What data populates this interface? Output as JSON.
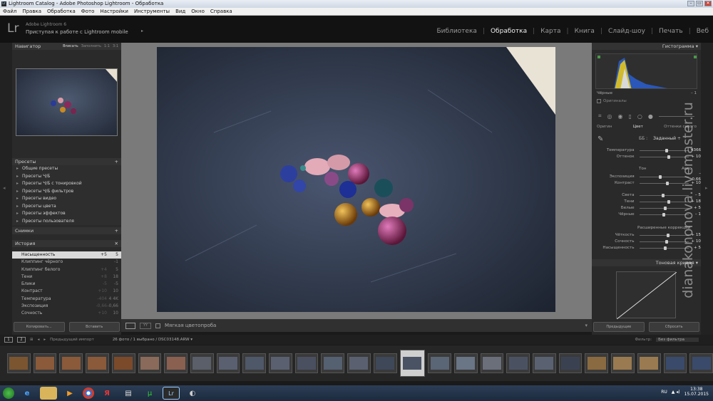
{
  "window": {
    "title": "Lightroom Catalog - Adobe Photoshop Lightroom - Обработка",
    "controls": [
      "–",
      "▭",
      "✕"
    ]
  },
  "menu": [
    "Файл",
    "Правка",
    "Обработка",
    "Фото",
    "Настройки",
    "Инструменты",
    "Вид",
    "Окно",
    "Справка"
  ],
  "identity": {
    "logo": "Lr",
    "version": "Adobe Lightroom 6",
    "sync": "Приступая к работе с Lightroom mobile",
    "arrow": "▸"
  },
  "modules": [
    {
      "label": "Библиотека",
      "active": false
    },
    {
      "label": "Обработка",
      "active": true
    },
    {
      "label": "Карта",
      "active": false
    },
    {
      "label": "Книга",
      "active": false
    },
    {
      "label": "Слайд-шоу",
      "active": false
    },
    {
      "label": "Печать",
      "active": false
    },
    {
      "label": "Веб",
      "active": false
    }
  ],
  "navigator": {
    "title": "Навигатор",
    "fit": "Вписать",
    "fill": "Заполнить",
    "z1": "1:1",
    "z3": "3:1"
  },
  "presets": {
    "title": "Пресеты",
    "items": [
      "Общие пресеты",
      "Пресеты Ч/Б",
      "Пресеты Ч/Б с тонировкой",
      "Пресеты Ч/Б фильтров",
      "Пресеты видео",
      "Пресеты цвета",
      "Пресеты эффектов",
      "Пресеты пользователя"
    ]
  },
  "snapshots": {
    "title": "Снимки"
  },
  "history": {
    "title": "История",
    "items": [
      {
        "name": "Насыщенность",
        "a": "+5",
        "b": "5",
        "selected": true
      },
      {
        "name": "Клиппинг чёрного",
        "a": "",
        "b": "-1"
      },
      {
        "name": "Клиппинг белого",
        "a": "+4",
        "b": "5"
      },
      {
        "name": "Тени",
        "a": "+8",
        "b": "18"
      },
      {
        "name": "Блики",
        "a": "-5",
        "b": "-5"
      },
      {
        "name": "Контраст",
        "a": "+10",
        "b": "10"
      },
      {
        "name": "Температура",
        "a": "-404",
        "b": "4 4K"
      },
      {
        "name": "Экспозиция",
        "a": "-0,66",
        "b": "-0,66"
      },
      {
        "name": "Сочность",
        "a": "+10",
        "b": "10"
      }
    ]
  },
  "left_buttons": {
    "copy": "Копировать...",
    "paste": "Вставить"
  },
  "toolbar": {
    "softproof": "Мягкая цветопроба"
  },
  "histogram": {
    "title": "Гистограмма",
    "blacks": "Чёрные",
    "blacks_val": "– 1",
    "originals": "Оригиналы"
  },
  "basic": {
    "tabs": [
      "Оригин",
      "Цвет",
      "Оттенки серого"
    ],
    "wb_label": "ББ :",
    "wb_value": "Заданный ÷",
    "temp": {
      "label": "Температура",
      "value": "4366",
      "pos": 0.55
    },
    "tint": {
      "label": "Оттенок",
      "value": "+ 10",
      "pos": 0.6
    },
    "tone_label": "Тон",
    "auto": "Авто",
    "exposure": {
      "label": "Экспозиция",
      "value": "– 0,66",
      "pos": 0.42
    },
    "contrast": {
      "label": "Контраст",
      "value": "+ 10",
      "pos": 0.56
    },
    "highlights": {
      "label": "Света",
      "value": "– 5",
      "pos": 0.47
    },
    "shadows": {
      "label": "Тени",
      "value": "+ 18",
      "pos": 0.6
    },
    "whites": {
      "label": "Белые",
      "value": "+ 5",
      "pos": 0.52
    },
    "blacks": {
      "label": "Чёрные",
      "value": "– 1",
      "pos": 0.49
    },
    "presence": "Расширенные коррекции",
    "clarity": {
      "label": "Чёткость",
      "value": "+ 15",
      "pos": 0.58
    },
    "vibrance": {
      "label": "Сочность",
      "value": "+ 10",
      "pos": 0.55
    },
    "saturation": {
      "label": "Насыщенность",
      "value": "+ 5",
      "pos": 0.52
    }
  },
  "tonecurve": {
    "title": "Тоновая кривая"
  },
  "right_buttons": {
    "previous": "Предыдущие",
    "reset": "Сбросить"
  },
  "filmbar": {
    "view1": "1",
    "view2": "2",
    "source": "Предыдущий импорт",
    "count": "26 фото / 1 выбрано / DSC03148.ARW ▾",
    "filter_label": "Фильтр:",
    "filter_value": "Без фильтра"
  },
  "taskbar": {
    "lang": "RU",
    "time": "13:38",
    "date": "15.07.2015"
  },
  "watermark": "dianakononova.livemaster.ru",
  "colors": {
    "accent": "#eeeeee",
    "panel": "#2a2a2a",
    "canvas": "#7a7a7a"
  }
}
